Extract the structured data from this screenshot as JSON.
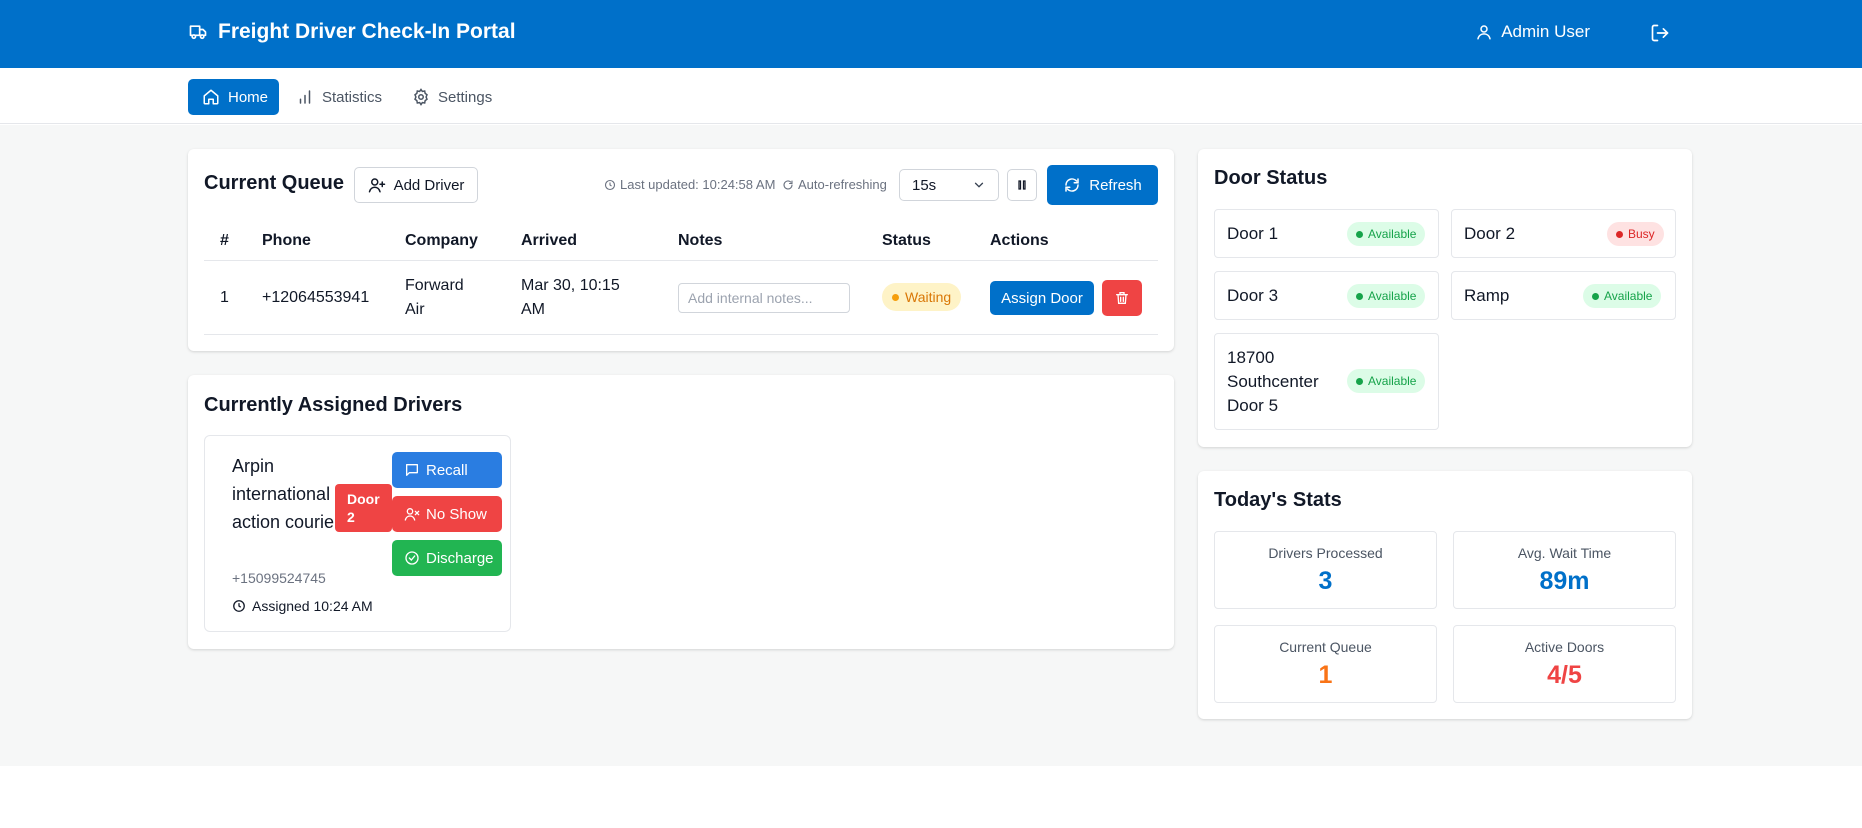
{
  "app": {
    "title": "Freight Driver Check-In Portal",
    "user": "Admin User"
  },
  "nav": {
    "home": "Home",
    "statistics": "Statistics",
    "settings": "Settings"
  },
  "queue": {
    "title": "Current Queue",
    "add_driver": "Add Driver",
    "last_updated": "Last updated: 10:24:58 AM",
    "auto_refresh": "Auto-refreshing",
    "interval": "15s",
    "refresh": "Refresh",
    "columns": [
      "#",
      "Phone",
      "Company",
      "Arrived",
      "Notes",
      "Status",
      "Actions"
    ],
    "rows": [
      {
        "num": "1",
        "phone": "+12064553941",
        "company": "Forward Air",
        "arrived": "Mar 30, 10:15 AM",
        "notes_placeholder": "Add internal notes...",
        "status": "Waiting",
        "assign": "Assign Door"
      }
    ]
  },
  "assigned": {
    "title": "Currently Assigned Drivers",
    "drivers": [
      {
        "name": "Arpin international / action courier",
        "door": "Door 2",
        "phone": "+15099524745",
        "assigned": "Assigned 10:24 AM",
        "recall": "Recall",
        "no_show": "No Show",
        "discharge": "Discharge"
      }
    ]
  },
  "doors": {
    "title": "Door Status",
    "items": [
      {
        "name": "Door 1",
        "status": "Available"
      },
      {
        "name": "Door 2",
        "status": "Busy"
      },
      {
        "name": "Door 3",
        "status": "Available"
      },
      {
        "name": "Ramp",
        "status": "Available"
      },
      {
        "name": "18700 Southcenter Door 5",
        "status": "Available"
      }
    ]
  },
  "stats": {
    "title": "Today's Stats",
    "items": [
      {
        "label": "Drivers Processed",
        "value": "3",
        "color": "#0070c9"
      },
      {
        "label": "Avg. Wait Time",
        "value": "89m",
        "color": "#0070c9"
      },
      {
        "label": "Current Queue",
        "value": "1",
        "color": "#f97316"
      },
      {
        "label": "Active Doors",
        "value": "4/5",
        "color": "#ef4444"
      }
    ]
  },
  "colors": {
    "primary": "#0070c9",
    "danger": "#ef4444",
    "success": "#16a34a",
    "recall": "#2a7de1",
    "discharge": "#22b552"
  }
}
